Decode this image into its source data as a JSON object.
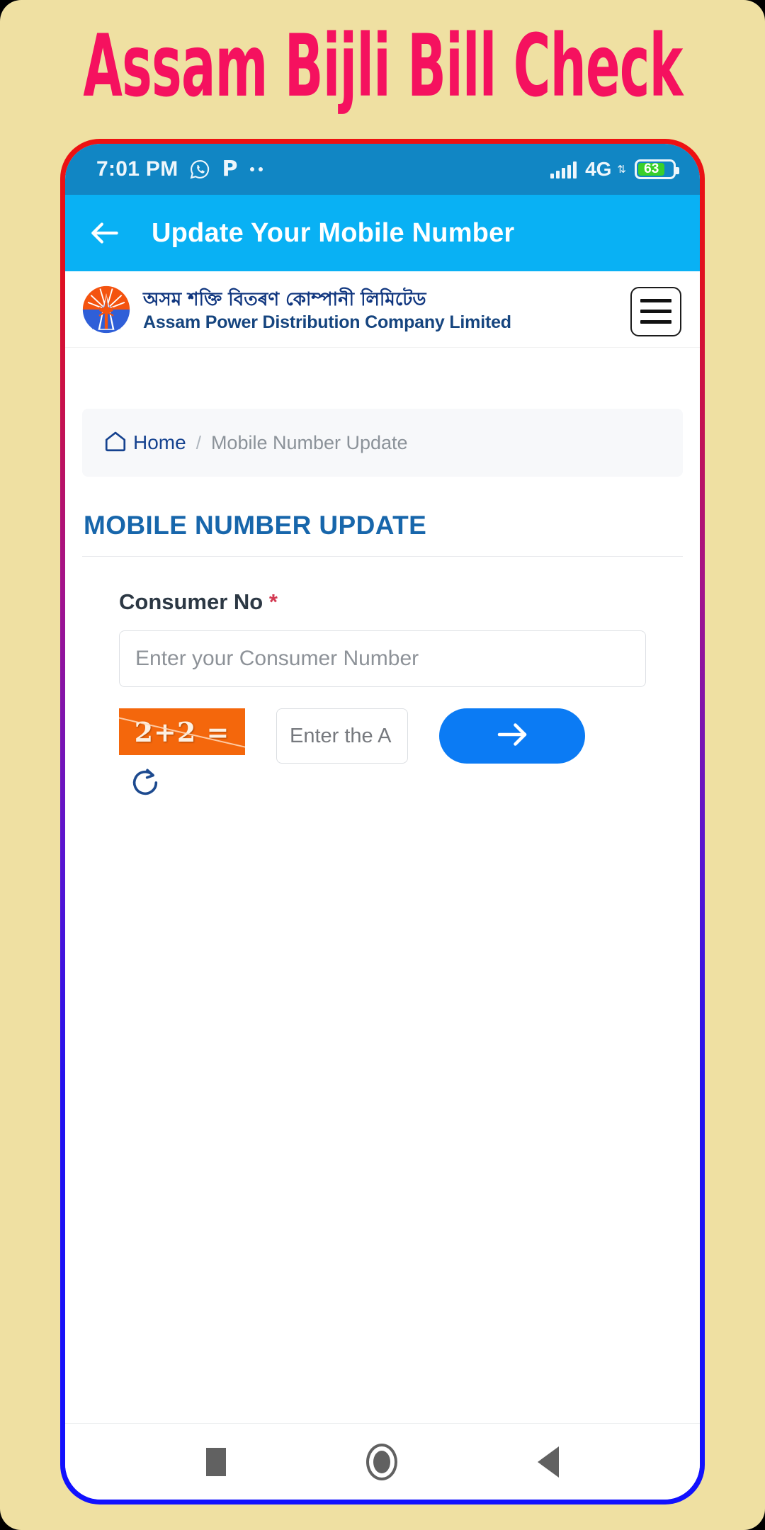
{
  "poster": {
    "title": "Assam Bijli Bill Check",
    "background_color": "#efe0a2",
    "title_color": "#f5115f"
  },
  "status_bar": {
    "time": "7:01 PM",
    "whatsapp_icon": "whatsapp-icon",
    "payment_icon_letter": "P",
    "overflow_dots": "..",
    "signal_icon": "signal-bars-icon",
    "network_type": "4G",
    "data_arrows": "⇅",
    "battery_percent": "63",
    "battery_color": "#39d02b",
    "background_color": "#1186c4"
  },
  "app_bar": {
    "back_icon": "arrow-left-icon",
    "title": "Update Your Mobile Number",
    "background_color": "#09b1f4"
  },
  "site_header": {
    "logo_icon": "apdcl-logo-icon",
    "name_assamese": "অসম শক্তি বিতৰণ কোম্পানী লিমিটেড",
    "name_english": "Assam Power Distribution Company Limited",
    "menu_icon": "hamburger-menu-icon"
  },
  "breadcrumb": {
    "home_icon": "home-icon",
    "home_label": "Home",
    "separator": "/",
    "current": "Mobile Number Update"
  },
  "page": {
    "title": "MOBILE NUMBER UPDATE",
    "title_color": "#1766ab"
  },
  "form": {
    "consumer_label": "Consumer No",
    "required_mark": "*",
    "consumer_placeholder": "Enter your Consumer Number",
    "consumer_value": "",
    "captcha_text": "2+2 =",
    "captcha_bg_color": "#f4670c",
    "refresh_icon": "refresh-icon",
    "captcha_placeholder": "Enter the A",
    "captcha_value": "",
    "submit_icon": "arrow-right-icon",
    "submit_color": "#0b7bf4"
  },
  "nav_bar": {
    "recents_icon": "square-recents-icon",
    "home_icon": "circle-home-icon",
    "back_icon": "triangle-back-icon"
  }
}
